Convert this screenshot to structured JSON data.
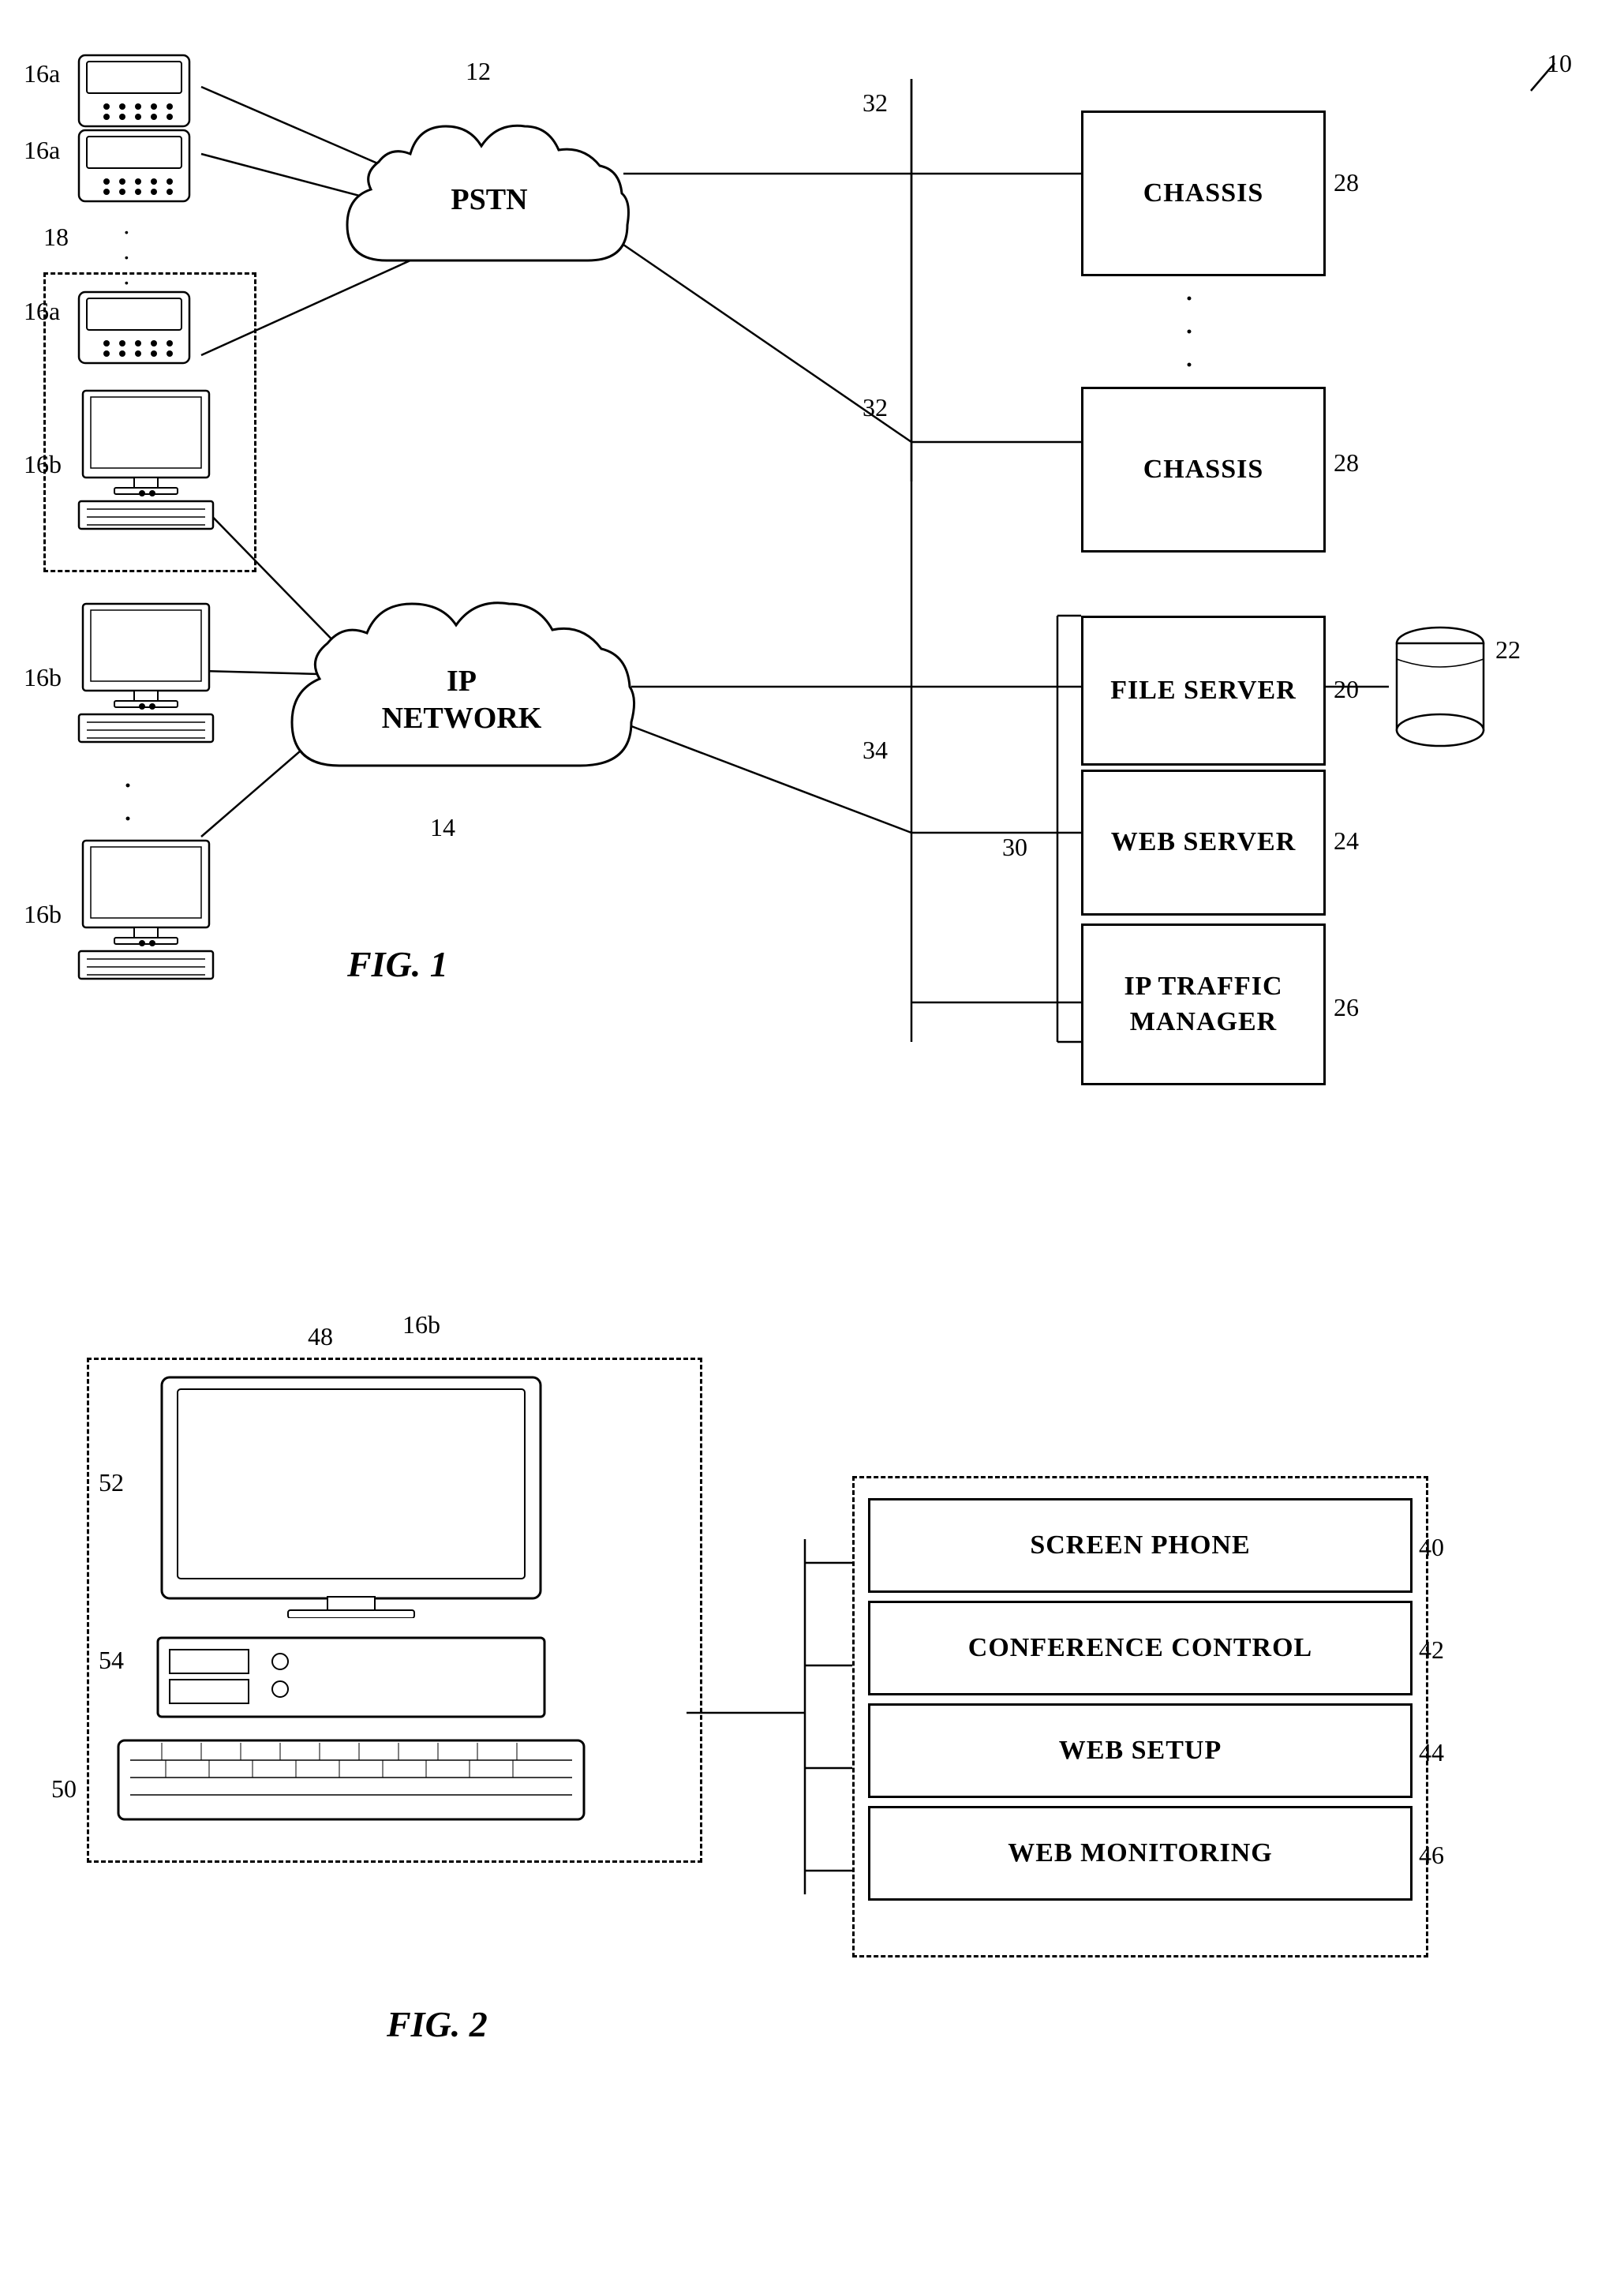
{
  "fig1": {
    "label": "FIG. 1",
    "ref10": "10",
    "ref12": "12",
    "ref14": "14",
    "ref16a_1": "16a",
    "ref16a_2": "16a",
    "ref16a_3": "16a",
    "ref16b_1": "16b",
    "ref16b_2": "16b",
    "ref16b_3": "16b",
    "ref18": "18",
    "ref20": "20",
    "ref22": "22",
    "ref24": "24",
    "ref26": "26",
    "ref28_1": "28",
    "ref28_2": "28",
    "ref30": "30",
    "ref32_1": "32",
    "ref32_2": "32",
    "ref34": "34",
    "pstn_label": "PSTN",
    "ip_network_label": "IP\nNETWORK",
    "chassis1_label": "CHASSIS",
    "chassis2_label": "CHASSIS",
    "file_server_label": "FILE\nSERVER",
    "web_server_label": "WEB\nSERVER",
    "ip_traffic_manager_label": "IP TRAFFIC\nMANAGER"
  },
  "fig2": {
    "label": "FIG. 2",
    "ref16b": "16b",
    "ref40": "40",
    "ref42": "42",
    "ref44": "44",
    "ref46": "46",
    "ref48": "48",
    "ref50": "50",
    "ref52": "52",
    "ref54": "54",
    "screen_phone_label": "SCREEN PHONE",
    "conference_control_label": "CONFERENCE CONTROL",
    "web_setup_label": "WEB SETUP",
    "web_monitoring_label": "WEB MONITORING"
  }
}
